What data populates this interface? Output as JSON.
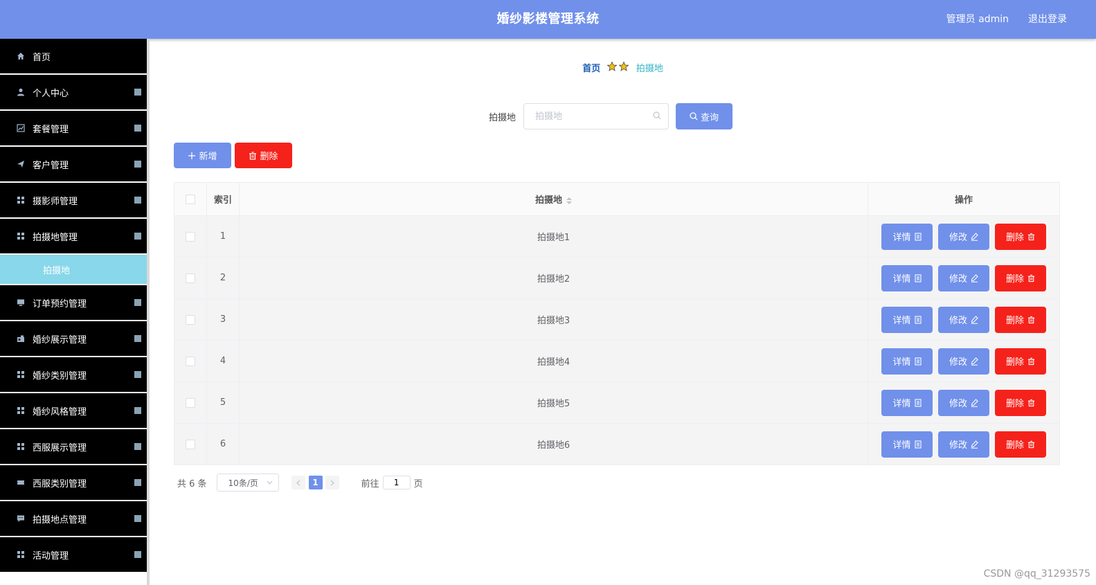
{
  "header": {
    "title": "婚纱影楼管理系统",
    "user": "管理员 admin",
    "logout": "退出登录"
  },
  "sidebar": {
    "items": [
      {
        "label": "首页",
        "icon": "home-icon"
      },
      {
        "label": "个人中心",
        "icon": "user-icon"
      },
      {
        "label": "套餐管理",
        "icon": "chart-icon"
      },
      {
        "label": "客户管理",
        "icon": "send-icon"
      },
      {
        "label": "摄影师管理",
        "icon": "grid-icon"
      },
      {
        "label": "拍摄地管理",
        "icon": "grid-icon"
      },
      {
        "label": "订单预约管理",
        "icon": "monitor-icon"
      },
      {
        "label": "婚纱展示管理",
        "icon": "camera-icon"
      },
      {
        "label": "婚纱类别管理",
        "icon": "grid-icon"
      },
      {
        "label": "婚纱风格管理",
        "icon": "grid-icon"
      },
      {
        "label": "西服展示管理",
        "icon": "grid-icon"
      },
      {
        "label": "西服类别管理",
        "icon": "ticket-icon"
      },
      {
        "label": "拍摄地点管理",
        "icon": "chat-icon"
      },
      {
        "label": "活动管理",
        "icon": "grid-icon"
      }
    ],
    "submenu": {
      "label": "拍摄地"
    }
  },
  "breadcrumb": {
    "home": "首页",
    "current": "拍摄地"
  },
  "search": {
    "label": "拍摄地",
    "placeholder": "拍摄地",
    "value": "",
    "button": "查询"
  },
  "actions": {
    "add": "新增",
    "delete": "删除"
  },
  "table": {
    "headers": {
      "index": "索引",
      "location": "拍摄地",
      "ops": "操作"
    },
    "rows": [
      {
        "index": "1",
        "location": "拍摄地1"
      },
      {
        "index": "2",
        "location": "拍摄地2"
      },
      {
        "index": "3",
        "location": "拍摄地3"
      },
      {
        "index": "4",
        "location": "拍摄地4"
      },
      {
        "index": "5",
        "location": "拍摄地5"
      },
      {
        "index": "6",
        "location": "拍摄地6"
      }
    ],
    "op_labels": {
      "detail": "详情",
      "edit": "修改",
      "delete": "删除"
    }
  },
  "pagination": {
    "total": "共 6 条",
    "page_size": "10条/页",
    "current_page": "1",
    "goto_label": "前往",
    "goto_value": "1",
    "page_suffix": "页"
  },
  "watermark": "CSDN @qq_31293575",
  "colors": {
    "header": "#7090ea",
    "primary": "#7090ea",
    "danger": "#f5221b",
    "sidebar": "#000000",
    "submenu": "#89d7ea"
  }
}
